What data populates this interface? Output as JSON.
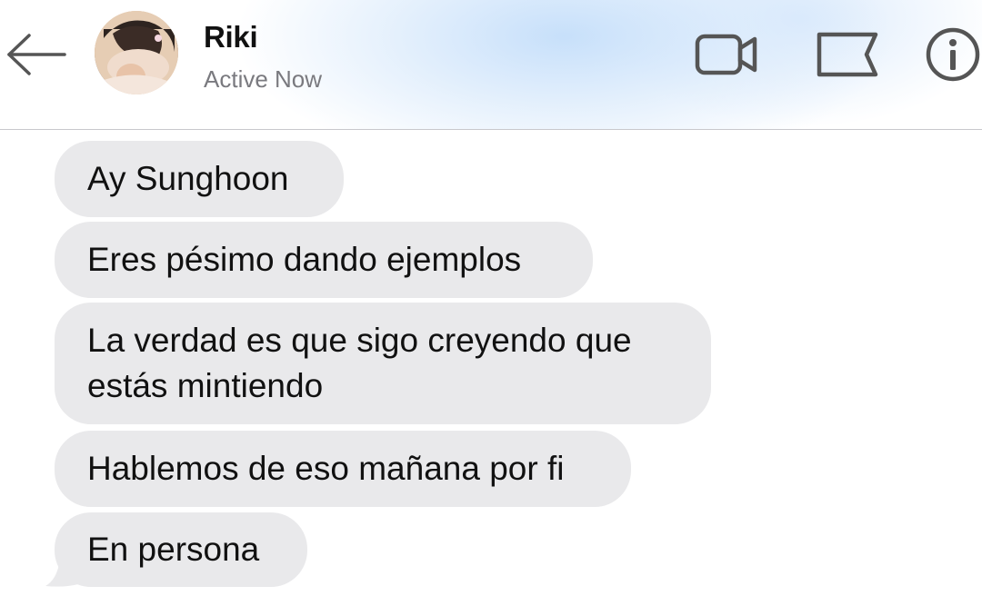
{
  "header": {
    "contact_name": "Riki",
    "status": "Active Now",
    "icons": {
      "back": "arrow-left-icon",
      "video": "video-camera-icon",
      "flag": "flag-icon",
      "info": "info-icon"
    }
  },
  "messages": [
    {
      "text": "Ay Sunghoon"
    },
    {
      "text": "Eres pésimo dando ejemplos"
    },
    {
      "text": "La verdad es que sigo creyendo que\nestás mintiendo"
    },
    {
      "text": "Hablemos de eso mañana por fi"
    },
    {
      "text": "En persona"
    }
  ],
  "colors": {
    "bubble_bg": "#e9e9eb",
    "icon_color": "#555555",
    "header_tint": "#cfe3fa"
  }
}
